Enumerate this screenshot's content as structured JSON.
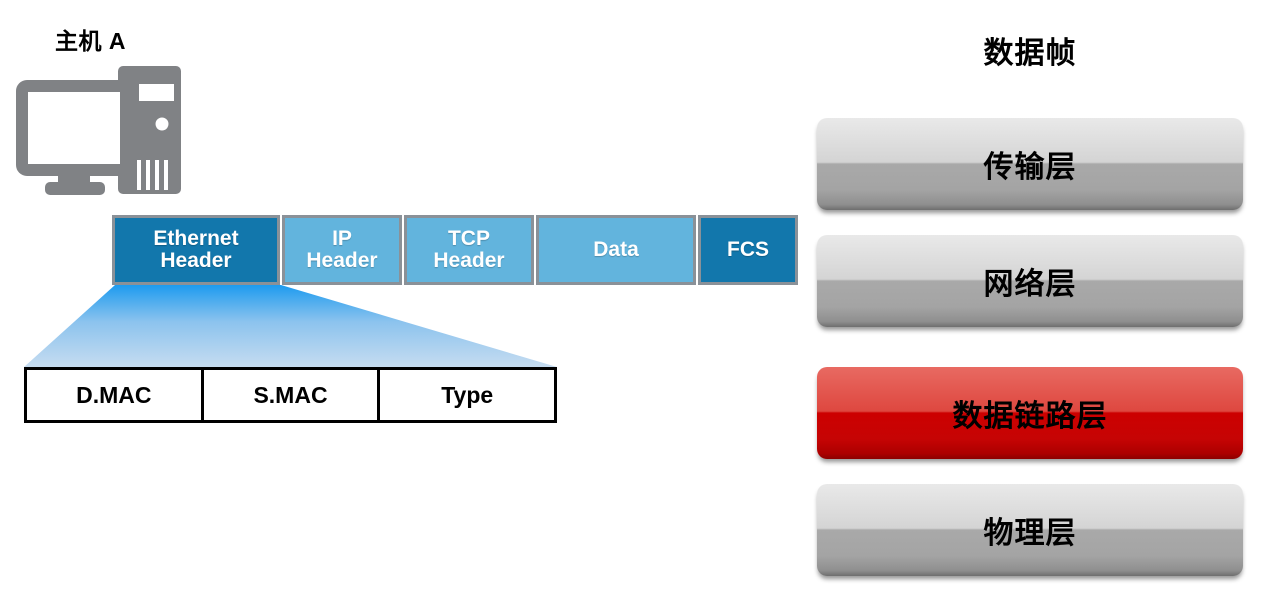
{
  "host": {
    "label": "主机 A",
    "icon": "desktop-computer-icon"
  },
  "frame": {
    "cells": [
      {
        "label": "Ethernet\nHeader",
        "line1": "Ethernet",
        "line2": "Header",
        "tone": "dark",
        "color": "#1277ac"
      },
      {
        "label": "IP\nHeader",
        "line1": "IP",
        "line2": "Header",
        "tone": "light",
        "color": "#62b4dd"
      },
      {
        "label": "TCP\nHeader",
        "line1": "TCP",
        "line2": "Header",
        "tone": "light",
        "color": "#62b4dd"
      },
      {
        "label": "Data",
        "line1": "Data",
        "line2": "",
        "tone": "light",
        "color": "#62b4dd"
      },
      {
        "label": "FCS",
        "line1": "FCS",
        "line2": "",
        "tone": "dark",
        "color": "#1277ac"
      }
    ]
  },
  "mac_table": {
    "cells": [
      {
        "label": "D.MAC"
      },
      {
        "label": "S.MAC"
      },
      {
        "label": "Type"
      }
    ]
  },
  "stack": {
    "title": "数据帧",
    "layers": [
      {
        "label": "传输层",
        "tone": "gray",
        "color": "#d4d4d4",
        "highlighted": false
      },
      {
        "label": "网络层",
        "tone": "gray",
        "color": "#d4d4d4",
        "highlighted": false
      },
      {
        "label": "数据链路层",
        "tone": "red",
        "color": "#cc0000",
        "highlighted": true
      },
      {
        "label": "物理层",
        "tone": "gray",
        "color": "#d4d4d4",
        "highlighted": false
      }
    ]
  },
  "colors": {
    "frame_dark_blue": "#1277ac",
    "frame_light_blue": "#62b4dd",
    "frame_border_gray": "#8a9198",
    "connector_blue": "#1e9bef",
    "highlight_red": "#cc0000",
    "layer_gray": "#d4d4d4",
    "icon_gray": "#808285",
    "text_black": "#000000"
  }
}
